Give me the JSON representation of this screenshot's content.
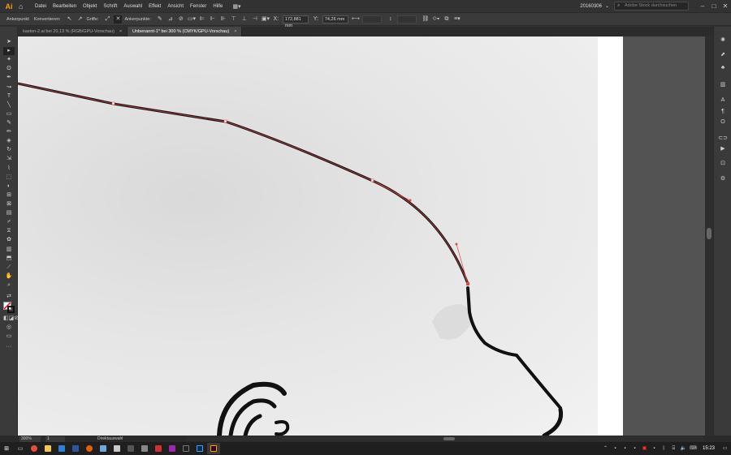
{
  "app": {
    "logo": "Ai"
  },
  "menu": [
    "Datei",
    "Bearbeiten",
    "Objekt",
    "Schrift",
    "Auswahl",
    "Effekt",
    "Ansicht",
    "Fenster",
    "Hilfe"
  ],
  "workspace": {
    "name": "20160306"
  },
  "search": {
    "placeholder": "Adobe Stock durchsuchen"
  },
  "control": {
    "ankerpunkt": "Ankerpunkt",
    "konvertieren": "Konvertieren:",
    "griffe": "Griffe:",
    "ankerpunkte": "Ankerpunkte:",
    "x": "172,881 mm",
    "y": "74,26 mm"
  },
  "tabs": [
    {
      "label": "kasten-2.ai bei 20,13 % (RGB/GPU-Vorschau)",
      "active": false
    },
    {
      "label": "Unbenannt-1* bei 300 % (CMYK/GPU-Vorschau)",
      "active": true
    }
  ],
  "status": {
    "zoom": "300%",
    "page": "1",
    "tool": "Direktauswahl"
  },
  "clock": "15:23",
  "colors": {
    "accent": "#ff9a00",
    "path": "#e04a4a"
  }
}
